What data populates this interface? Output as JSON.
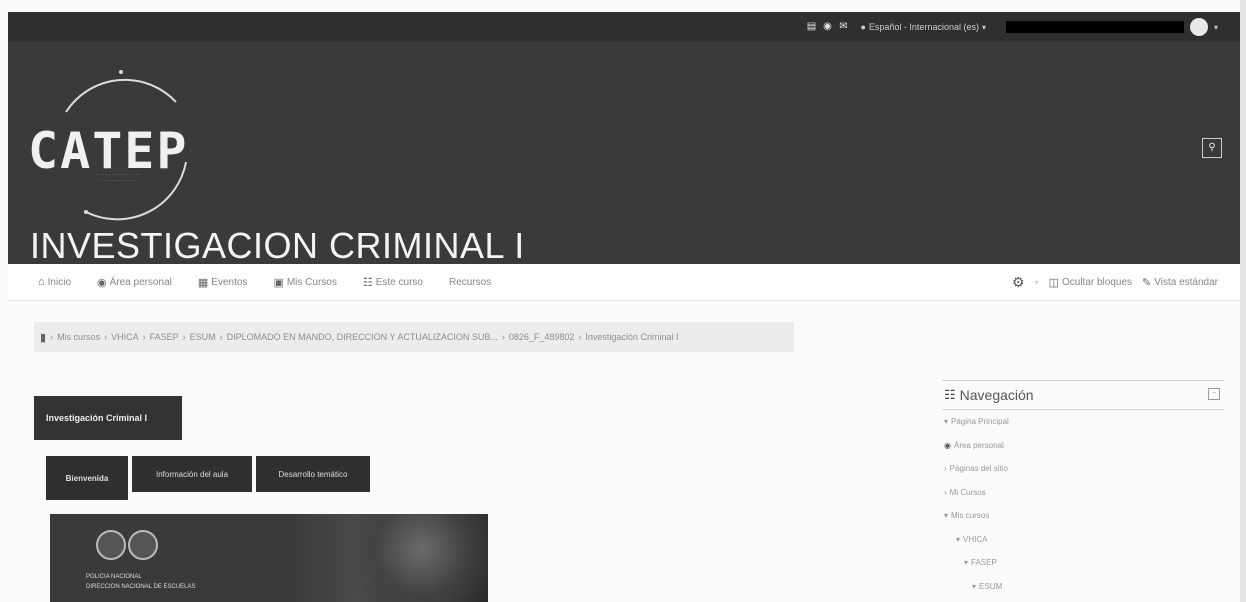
{
  "topbar": {
    "language": "Español - Internacional (es)",
    "language_icon": "globe-icon",
    "icons": [
      "clipboard-icon",
      "chat-icon",
      "envelope-icon"
    ]
  },
  "header": {
    "logo_text": "CATEP",
    "course_title": "INVESTIGACION CRIMINAL I",
    "search_icon": "search-icon"
  },
  "nav": {
    "items": [
      {
        "label": "Inicio",
        "icon": "home-icon"
      },
      {
        "label": "Área personal",
        "icon": "dashboard-icon"
      },
      {
        "label": "Eventos",
        "icon": "calendar-icon"
      },
      {
        "label": "Mis Cursos",
        "icon": "briefcase-icon"
      },
      {
        "label": "Este curso",
        "icon": "sitemap-icon"
      },
      {
        "label": "Recursos",
        "icon": ""
      }
    ],
    "hide_blocks": "Ocultar bloques",
    "standard_view": "Vista estándar"
  },
  "breadcrumb": {
    "items": [
      "Mis cursos",
      "VHICA",
      "FASEP",
      "ESUM",
      "DIPLOMADO EN MANDO, DIRECCION Y ACTUALIZACION SUB...",
      "0826_F_489802",
      "Investigación Criminal I"
    ]
  },
  "main": {
    "section_title": "Investigación Criminal I",
    "tabs": [
      "Bienvenida",
      "Información del aula",
      "Desarrollo temático"
    ],
    "hero_line1": "POLICIA NACIONAL",
    "hero_line2": "DIRECCION NACIONAL DE ESCUELAS"
  },
  "navigation_block": {
    "title": "Navegación",
    "items": [
      {
        "label": "Página Principal",
        "level": 0,
        "marker": "▾"
      },
      {
        "label": "Área personal",
        "level": 0,
        "marker": "dashboard"
      },
      {
        "label": "Páginas del sitio",
        "level": 0,
        "marker": "›"
      },
      {
        "label": "Mi Cursos",
        "level": 0,
        "marker": "›"
      },
      {
        "label": "Mis cursos",
        "level": 0,
        "marker": "▾"
      },
      {
        "label": "VHICA",
        "level": 1,
        "marker": "▾"
      },
      {
        "label": "FASEP",
        "level": 2,
        "marker": "▾"
      },
      {
        "label": "ESUM",
        "level": 3,
        "marker": "▾"
      }
    ]
  }
}
